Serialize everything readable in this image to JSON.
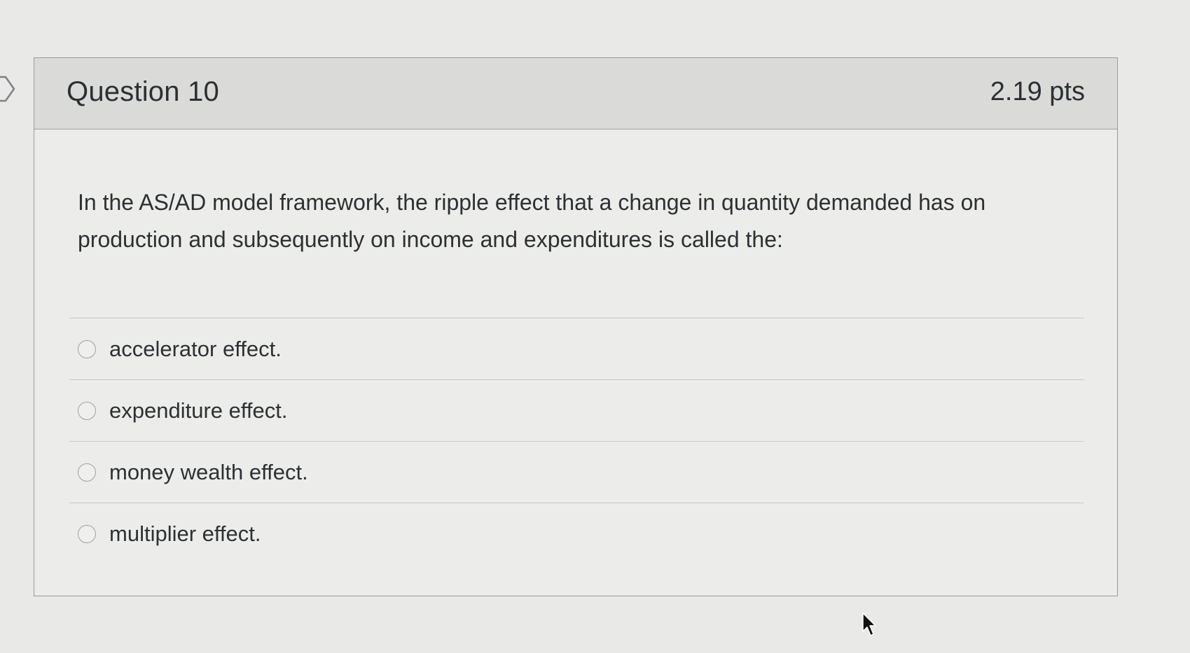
{
  "question": {
    "title": "Question 10",
    "points": "2.19 pts",
    "text": "In the AS/AD model framework, the ripple effect that a change in quantity demanded has on production and subsequently on income and expenditures is called the:"
  },
  "answers": [
    {
      "label": "accelerator effect.",
      "selected": false
    },
    {
      "label": "expenditure effect.",
      "selected": false
    },
    {
      "label": "money wealth effect.",
      "selected": false
    },
    {
      "label": "multiplier effect.",
      "selected": false
    }
  ],
  "icons": {
    "left_marker": "chevron-right-icon",
    "cursor": "mouse-pointer-icon"
  },
  "colors": {
    "header_background": "#dadad8",
    "card_background": "#ecedeb",
    "text": "#2d3033"
  }
}
